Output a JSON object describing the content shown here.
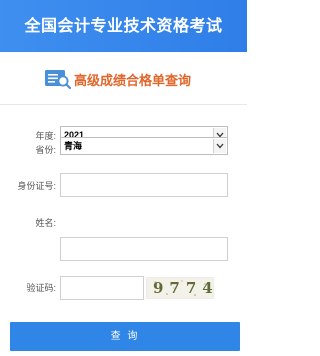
{
  "header": {
    "title": "全国会计专业技术资格考试"
  },
  "sub_banner": {
    "title": "高级成绩合格单查询",
    "icon": "search-document-icon"
  },
  "form": {
    "year": {
      "label": "年度:",
      "value": "2021"
    },
    "province": {
      "label": "省份:",
      "value": "青海"
    },
    "id_number": {
      "label": "身份证号:",
      "value": ""
    },
    "name": {
      "label": "姓名:",
      "value": ""
    },
    "captcha": {
      "label": "验证码:",
      "value": "",
      "image_text": "9774"
    }
  },
  "submit": {
    "label": "查 询"
  },
  "colors": {
    "header_bg": "#3a8aee",
    "accent_orange": "#e0662b",
    "button_bg": "#2f86e6"
  }
}
